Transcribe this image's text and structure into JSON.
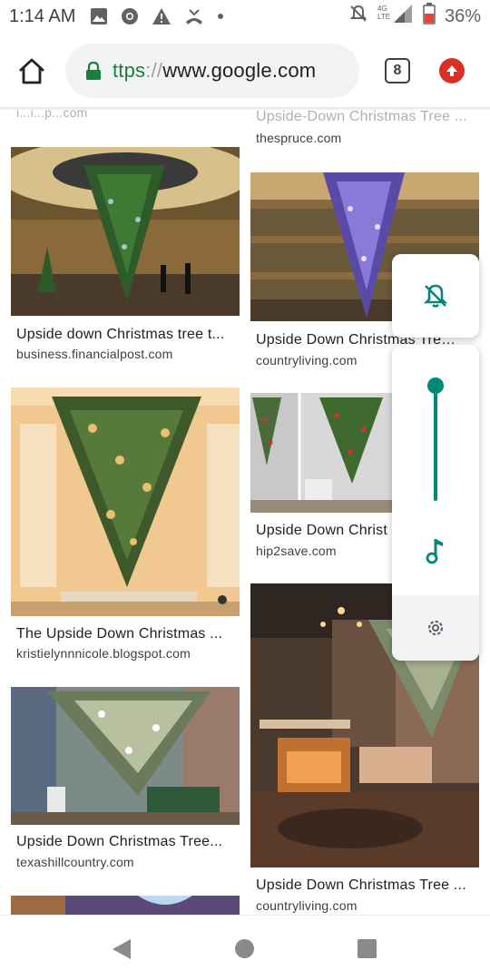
{
  "status_bar": {
    "time": "1:14 AM",
    "left_icons": [
      "image-icon",
      "chrome-icon",
      "warning-icon",
      "missed-call-icon",
      "dot-icon"
    ],
    "right_icons": [
      "do-not-disturb-icon",
      "lte-signal-icon",
      "battery-icon"
    ],
    "network_label": "4G LTE",
    "battery": "36%"
  },
  "browser": {
    "url_scheme_partial": "ttps",
    "url_separator": "://",
    "url_host": "www.google.com",
    "tab_count": "8",
    "icons": {
      "home": "home-icon",
      "lock": "lock-icon",
      "update": "update-arrow-icon"
    }
  },
  "results": {
    "left": [
      {
        "title": "",
        "source": "i...i...p...com"
      },
      {
        "title": "Upside down Christmas tree t...",
        "source": "business.financialpost.com"
      },
      {
        "title": "The Upside Down Christmas ...",
        "source": "kristielynnnicole.blogspot.com"
      },
      {
        "title": "Upside Down Christmas Tree...",
        "source": "texashillcountry.com"
      }
    ],
    "right": [
      {
        "title": "Upside-Down Christmas Tree ...",
        "source": "thespruce.com"
      },
      {
        "title": "Upside Down Christmas Tree ...",
        "source": "countryliving.com"
      },
      {
        "title": "Upside Down Christ",
        "source": "hip2save.com"
      },
      {
        "title": "Upside Down Christmas Tree ...",
        "source": "countryliving.com"
      }
    ]
  },
  "volume_panel": {
    "ringer_icon": "ringer-muted-icon",
    "media_icon": "music-note-icon",
    "settings_icon": "gear-icon",
    "media_level": 1.0,
    "accent": "#00897b"
  },
  "nav_bar": {
    "icons": [
      "back-icon",
      "home-circle-icon",
      "recents-square-icon"
    ]
  }
}
